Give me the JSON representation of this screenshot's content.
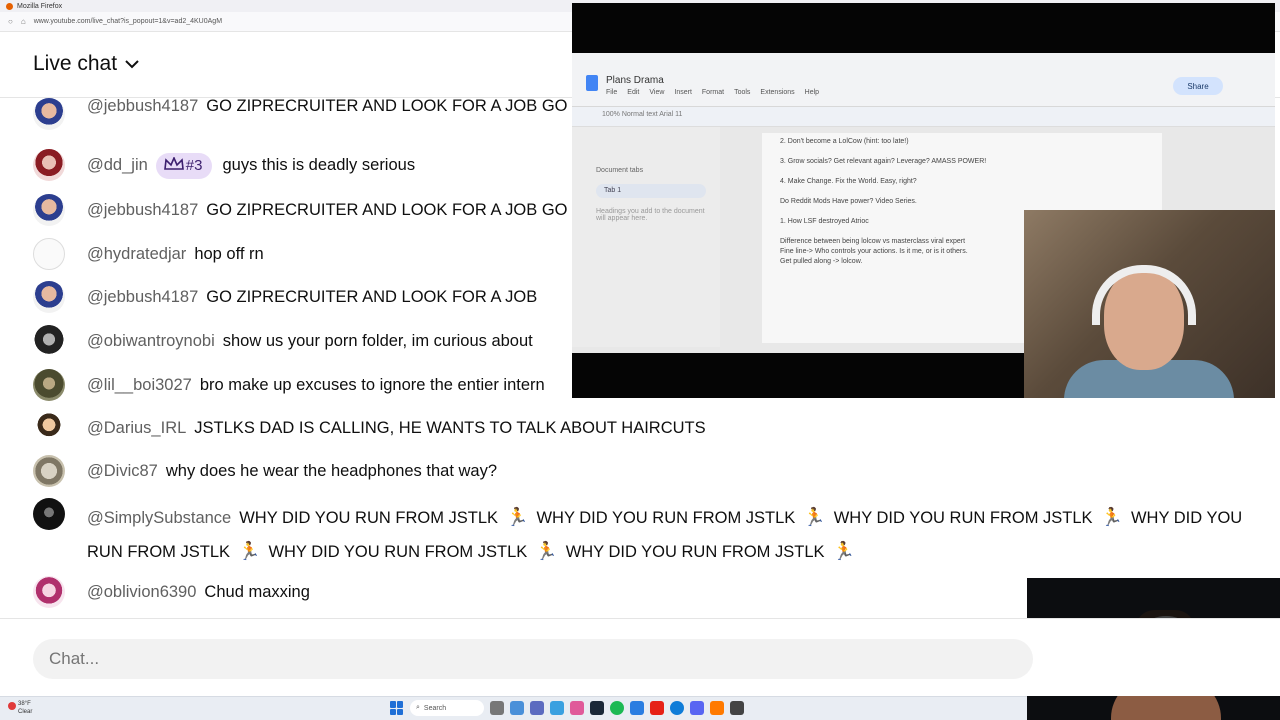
{
  "browser": {
    "window_title": "Mozilla Firefox",
    "url": "www.youtube.com/live_chat?is_popout=1&v=ad2_4KU0AgM"
  },
  "chat": {
    "title": "Live chat",
    "input_placeholder": "Chat...",
    "messages": [
      {
        "author": "@jebbush4187",
        "text": "GO ZIPRECRUITER AND LOOK FOR A JOB GO ZIPRECRUITER AND LOOK FOR A JOB GO ZIPRECRUITER AND"
      },
      {
        "author": "@dd_jin",
        "badge": "#3",
        "text": "guys this is deadly serious"
      },
      {
        "author": "@jebbush4187",
        "text": "GO ZIPRECRUITER AND LOOK FOR A JOB GO"
      },
      {
        "author": "@hydratedjar",
        "text": "hop off rn"
      },
      {
        "author": "@jebbush4187",
        "text": "GO ZIPRECRUITER AND LOOK FOR A JOB"
      },
      {
        "author": "@obiwantroynobi",
        "text": "show us your porn folder, im curious about"
      },
      {
        "author": "@lil__boi3027",
        "text": "bro make up excuses to ignore the entier intern"
      },
      {
        "author": "@Darius_IRL",
        "text": "JSTLKS DAD IS CALLING, HE WANTS TO TALK ABOUT HAIRCUTS"
      },
      {
        "author": "@Divic87",
        "text": "why does he wear the headphones that way?"
      },
      {
        "author": "@SimplySubstance",
        "segments": [
          "WHY DID YOU RUN FROM JSTLK",
          "WHY DID YOU RUN FROM JSTLK",
          "WHY DID YOU RUN FROM JSTLK",
          "WHY DID YOU RUN FROM JSTLK",
          "WHY DID YOU RUN FROM JSTLK",
          "WHY DID YOU RUN FROM JSTLK"
        ],
        "emoji": "🏃"
      },
      {
        "author": "@oblivion6390",
        "text": "Chud maxxing"
      }
    ]
  },
  "docs": {
    "title": "Plans Drama",
    "menu": [
      "File",
      "Edit",
      "View",
      "Insert",
      "Format",
      "Tools",
      "Extensions",
      "Help"
    ],
    "share": "Share",
    "toolbar": "100%   Normal text   Arial   11",
    "side_heading": "Document tabs",
    "side_tab": "Tab 1",
    "side_note": "Headings you add to the document will appear here.",
    "lines": [
      "2.  Don't become a LolCow (hint: too late!)",
      "3. Grow socials?  Get relevant again?  Leverage? AMASS POWER!",
      "4. Make Change.  Fix the World. Easy, right?",
      "Do Reddit Mods Have power?  Video Series.",
      "1.  How LSF destroyed Atrioc",
      "Difference between being lolcow vs masterclass viral expert",
      "Fine line-> Who controls your actions.  Is it me, or is it others.",
      "Get pulled along -> lolcow."
    ]
  },
  "taskbar": {
    "temperature": "38°F",
    "weather": "Clear",
    "search": "Search"
  }
}
